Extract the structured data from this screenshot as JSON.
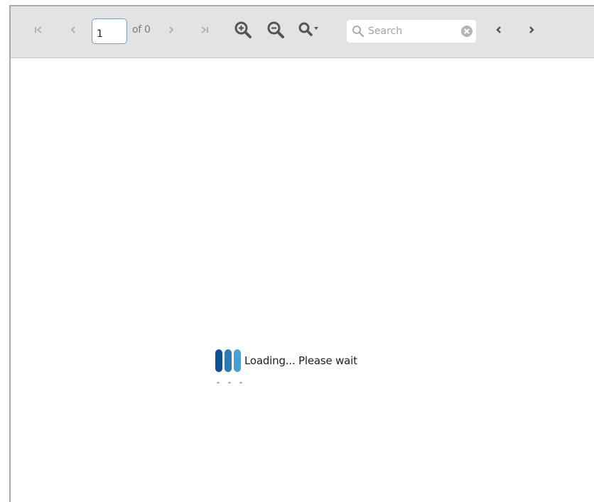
{
  "toolbar": {
    "page_value": "1",
    "of_label": "of 0",
    "search_placeholder": "Search"
  },
  "loading": {
    "text": "Loading... Please wait"
  },
  "colors": {
    "toolbar_bg": "#e3e3e3",
    "disabled_icon": "#b3b3b3",
    "active_icon": "#555555",
    "spinner_dark": "#0d4f92",
    "spinner_mid": "#2a79b8",
    "spinner_light": "#4aa0d0",
    "dot": "#7fb6c9"
  },
  "icons": {
    "first": "first-page-icon",
    "prev": "previous-page-icon",
    "next": "next-page-icon",
    "last": "last-page-icon",
    "zoom_in": "zoom-in-icon",
    "zoom_out": "zoom-out-icon",
    "zoom_menu": "zoom-menu-icon",
    "search": "search-icon",
    "clear": "clear-icon",
    "find_prev": "find-previous-icon",
    "find_next": "find-next-icon"
  }
}
